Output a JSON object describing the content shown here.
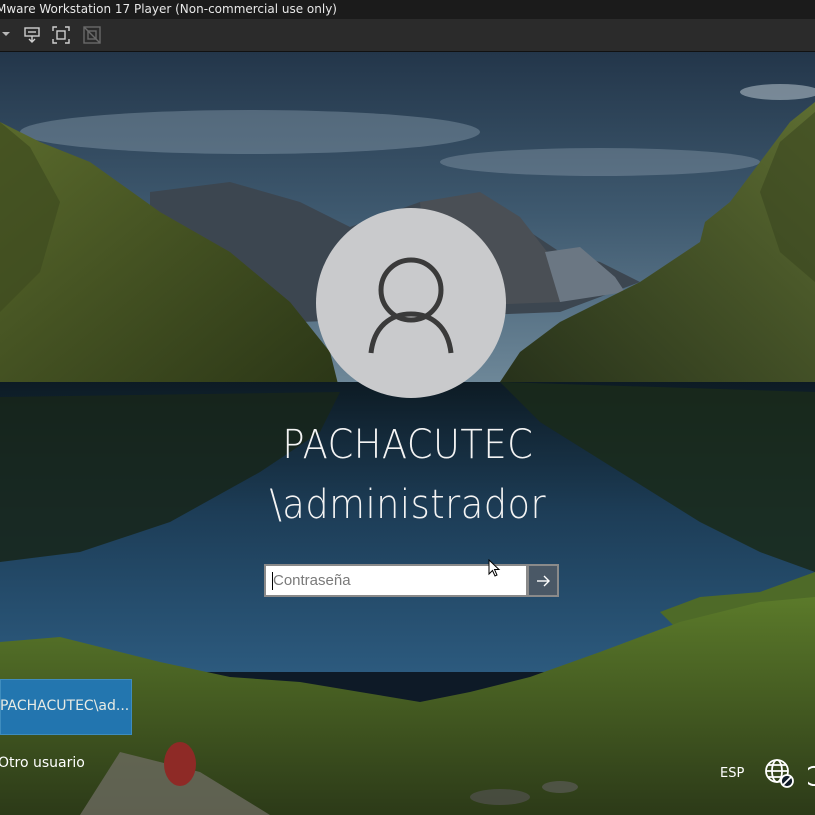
{
  "window": {
    "title": "Mware Workstation 17 Player (Non-commercial use only)"
  },
  "toolbar": {
    "icons": [
      "dropdown-arrow",
      "send-ctrl-alt-del-icon",
      "fullscreen-icon",
      "unity-icon"
    ]
  },
  "lockscreen": {
    "domain": "PACHACUTEC",
    "username": "\\administrador",
    "password_placeholder": "Contraseña",
    "users": [
      {
        "label": "PACHACUTEC\\ad...",
        "selected": true
      },
      {
        "label": "Otro usuario",
        "selected": false
      }
    ],
    "language": "ESP",
    "icons": [
      "user-avatar-icon",
      "submit-arrow-icon",
      "network-icon",
      "power-icon"
    ]
  },
  "colors": {
    "selected_tile": "#1f7ac3",
    "title_bar": "#1b1b1b",
    "toolbar": "#2b2b2b"
  }
}
